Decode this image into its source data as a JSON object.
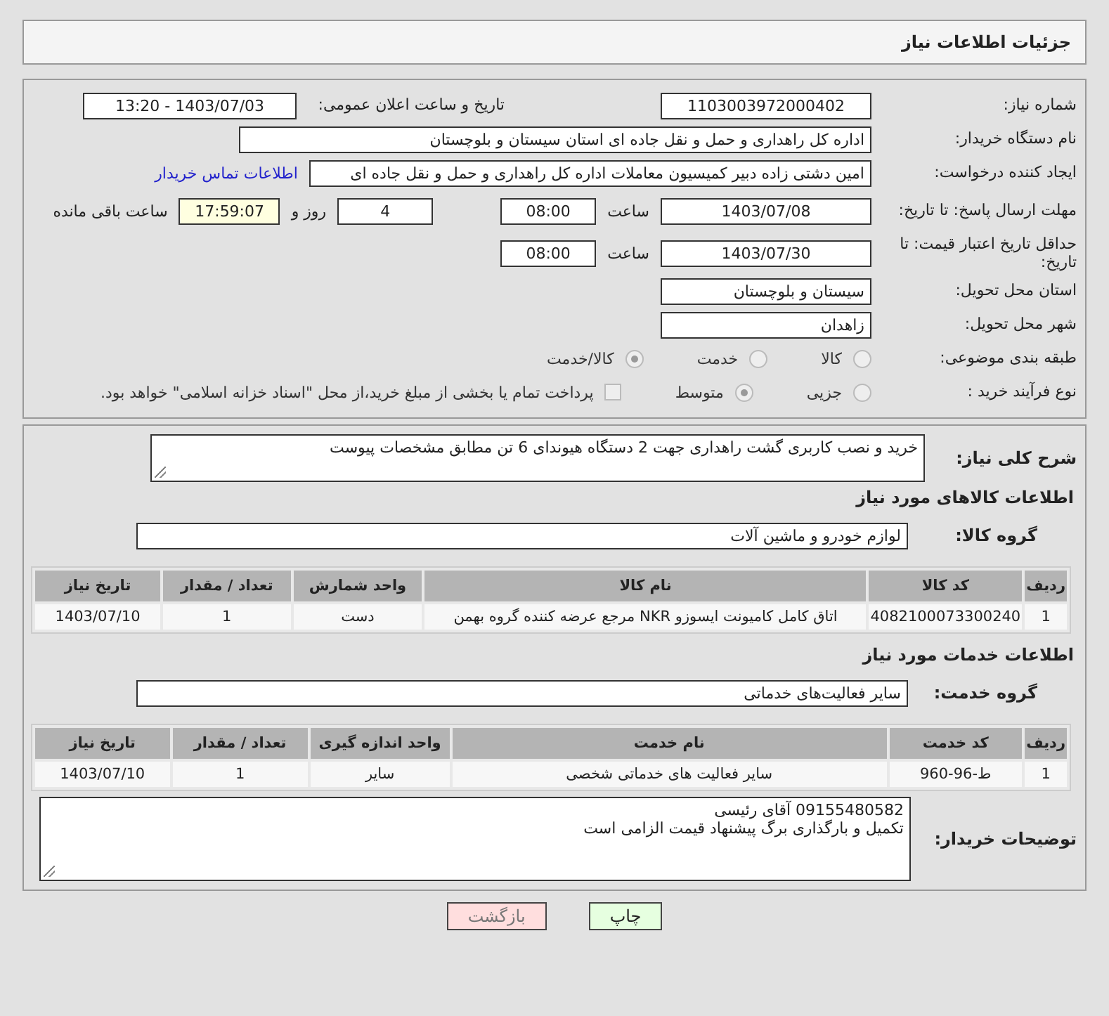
{
  "header": {
    "title": "جزئیات اطلاعات نیاز"
  },
  "fields": {
    "need_number": {
      "label": "شماره نیاز:",
      "value": "1103003972000402"
    },
    "announce": {
      "label": "تاریخ و ساعت اعلان عمومی:",
      "value": "1403/07/03 - 13:20"
    },
    "buyer_org": {
      "label": "نام دستگاه خریدار:",
      "value": "اداره کل راهداری و حمل و نقل جاده ای استان سیستان و بلوچستان"
    },
    "creator": {
      "label": "ایجاد کننده درخواست:",
      "value": "امین دشتی زاده دبیر کمیسیون معاملات اداره کل راهداری و حمل و نقل جاده ای",
      "link": "اطلاعات تماس خریدار"
    },
    "deadline": {
      "label": "مهلت ارسال پاسخ: تا تاریخ:",
      "date": "1403/07/08",
      "time_label": "ساعت",
      "time": "08:00",
      "days": "4",
      "days_label": "روز و",
      "remaining": "17:59:07",
      "remaining_label": "ساعت باقی مانده"
    },
    "validity": {
      "label": "حداقل تاریخ اعتبار قیمت: تا تاریخ:",
      "date": "1403/07/30",
      "time_label": "ساعت",
      "time": "08:00"
    },
    "province": {
      "label": "استان محل تحویل:",
      "value": "سیستان و بلوچستان"
    },
    "city": {
      "label": "شهر محل تحویل:",
      "value": "زاهدان"
    },
    "category": {
      "label": "طبقه بندی موضوعی:",
      "options": [
        {
          "label": "کالا",
          "selected": false
        },
        {
          "label": "خدمت",
          "selected": false
        },
        {
          "label": "کالا/خدمت",
          "selected": true
        }
      ]
    },
    "process": {
      "label": "نوع فرآیند خرید :",
      "options": [
        {
          "label": "جزیی",
          "selected": false
        },
        {
          "label": "متوسط",
          "selected": true
        }
      ],
      "payment": {
        "label": "پرداخت تمام یا بخشی از مبلغ خرید،از محل \"اسناد خزانه اسلامی\" خواهد بود.",
        "checked": false
      }
    }
  },
  "description": {
    "label": "شرح کلی نیاز:",
    "value": "خرید و نصب کاربری گشت راهداری جهت 2 دستگاه هیوندای 6 تن مطابق مشخصات پیوست"
  },
  "goods": {
    "title": "اطلاعات کالاهای مورد نیاز",
    "group_label": "گروه کالا:",
    "group": "لوازم خودرو و ماشین آلات",
    "columns": [
      "ردیف",
      "کد کالا",
      "نام کالا",
      "واحد شمارش",
      "تعداد / مقدار",
      "تاریخ نیاز"
    ],
    "rows": [
      [
        "1",
        "4082100073300240",
        "اتاق کامل کامیونت ایسوزو NKR مرجع عرضه کننده گروه بهمن",
        "دست",
        "1",
        "1403/07/10"
      ]
    ]
  },
  "services": {
    "title": "اطلاعات خدمات مورد نیاز",
    "group_label": "گروه خدمت:",
    "group": "سایر فعالیت‌های خدماتی",
    "columns": [
      "ردیف",
      "کد خدمت",
      "نام خدمت",
      "واحد اندازه گیری",
      "تعداد / مقدار",
      "تاریخ نیاز"
    ],
    "rows": [
      [
        "1",
        "ط-96-960",
        "سایر فعالیت های خدماتی شخصی",
        "سایر",
        "1",
        "1403/07/10"
      ]
    ]
  },
  "buyer_notes": {
    "label": "توضیحات خریدار:",
    "lines": [
      "09155480582 آقای رئیسی",
      "تکمیل و بارگذاری برگ پیشنهاد قیمت الزامی است"
    ]
  },
  "buttons": [
    {
      "label": "چاپ",
      "kind": "print"
    },
    {
      "label": "بازگشت",
      "kind": "back"
    }
  ]
}
